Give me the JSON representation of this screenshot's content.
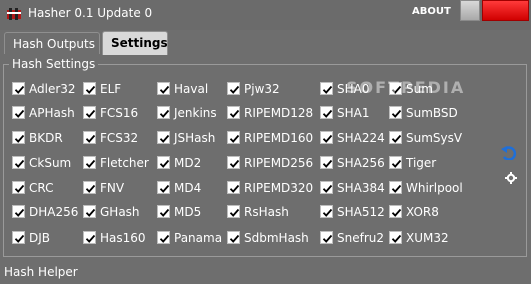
{
  "window": {
    "title": "Hasher 0.1 Update 0",
    "about_label": "ABOUT"
  },
  "tabs": [
    {
      "label": "Hash Outputs",
      "active": false
    },
    {
      "label": "Settings",
      "active": true
    }
  ],
  "settings": {
    "group_title": "Hash Settings",
    "columns": [
      [
        "Adler32",
        "APHash",
        "BKDR",
        "CkSum",
        "CRC",
        "DHA256",
        "DJB"
      ],
      [
        "ELF",
        "FCS16",
        "FCS32",
        "Fletcher",
        "FNV",
        "GHash",
        "Has160"
      ],
      [
        "Haval",
        "Jenkins",
        "JSHash",
        "MD2",
        "MD4",
        "MD5",
        "Panama"
      ],
      [
        "Pjw32",
        "RIPEMD128",
        "RIPEMD160",
        "RIPEMD256",
        "RIPEMD320",
        "RsHash",
        "SdbmHash"
      ],
      [
        "SHA0",
        "SHA1",
        "SHA224",
        "SHA256",
        "SHA384",
        "SHA512",
        "Snefru2"
      ],
      [
        "Sum",
        "SumBSD",
        "SumSysV",
        "Tiger",
        "Whirlpool",
        "XOR8",
        "XUM32"
      ]
    ],
    "all_checked": true
  },
  "icons": {
    "app": "hasher-app-icon",
    "undo": "undo-icon",
    "settings": "gear-icon"
  },
  "watermark": "SOFTPEDIA",
  "footer": {
    "label": "Hash Helper"
  },
  "colors": {
    "background": "#6e6e6e",
    "close_button": "#e81010",
    "accent_blue": "#1e6fd9"
  }
}
